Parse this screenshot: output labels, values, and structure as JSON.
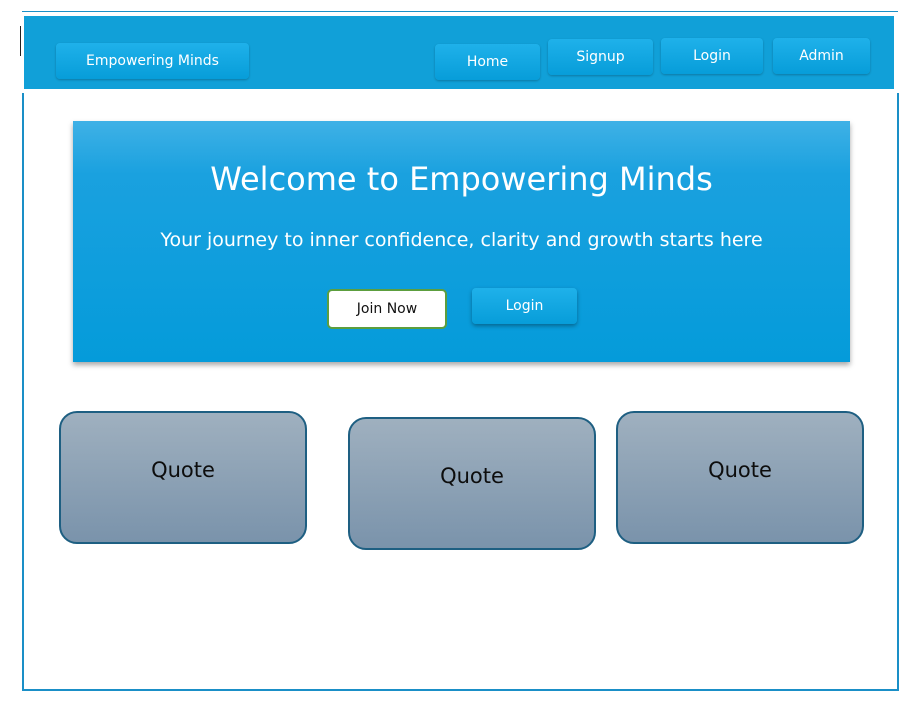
{
  "nav": {
    "brand": "Empowering Minds",
    "home": "Home",
    "signup": "Signup",
    "login": "Login",
    "admin": "Admin"
  },
  "hero": {
    "title": "Welcome to Empowering Minds",
    "subtitle": "Your journey to inner confidence, clarity and growth starts here",
    "join_label": "Join Now",
    "login_label": "Login"
  },
  "quotes": [
    {
      "label": "Quote"
    },
    {
      "label": "Quote"
    },
    {
      "label": "Quote"
    }
  ],
  "colors": {
    "primary": "#11a0d8",
    "frame_border": "#1a8fc7",
    "join_border": "#5c9e3e",
    "quote_fill": "#8fa3b6",
    "quote_border": "#1e5f82"
  }
}
